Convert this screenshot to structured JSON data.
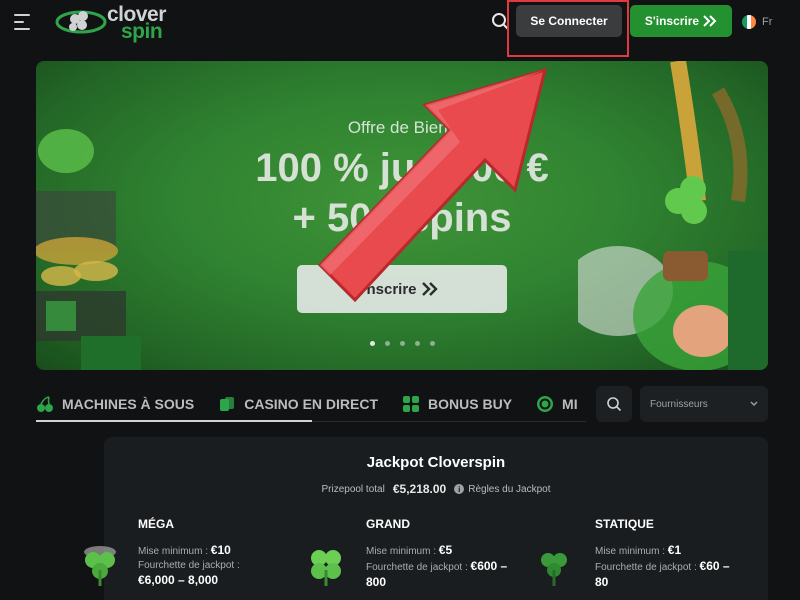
{
  "header": {
    "logo_word1": "clover",
    "logo_word2": "spin",
    "login_label": "Se Connecter",
    "signup_label": "S'inscrire",
    "language": "Fr"
  },
  "banner": {
    "offer_small": "Offre de Bienv",
    "offer_line1": "100 % jus        600 €",
    "offer_line2": "+ 50 f       spins",
    "cta_label": "nscrire",
    "dots_count": 5,
    "active_dot": 1
  },
  "tabs": [
    {
      "label": "MACHINES À SOUS",
      "icon": "cherries-icon"
    },
    {
      "label": "CASINO EN DIRECT",
      "icon": "cards-icon"
    },
    {
      "label": "BONUS BUY",
      "icon": "grid-icon"
    },
    {
      "label": "MI",
      "icon": "clock-icon"
    }
  ],
  "providers_label": "Fournisseurs",
  "jackpot": {
    "title": "Jackpot Cloverspin",
    "prize_label": "Prizepool total",
    "prize_amount": "€5,218.00",
    "rules_label": "Règles du Jackpot",
    "tiers": [
      {
        "name": "MÉGA",
        "min_label": "Mise minimum :",
        "min_value": "€10",
        "range_label": "Fourchette de jackpot :",
        "range_value": "€6,000 – 8,000"
      },
      {
        "name": "GRAND",
        "min_label": "Mise minimum :",
        "min_value": "€5",
        "range_label": "Fourchette de jackpot :",
        "range_value": "€600 – 800"
      },
      {
        "name": "STATIQUE",
        "min_label": "Mise minimum :",
        "min_value": "€1",
        "range_label": "Fourchette de jackpot :",
        "range_value": "€60 – 80"
      }
    ]
  },
  "colors": {
    "background": "#101213",
    "brand_green": "#23912f",
    "highlight_red": "#e03a3f",
    "banner_green": "#3a9f3c"
  }
}
